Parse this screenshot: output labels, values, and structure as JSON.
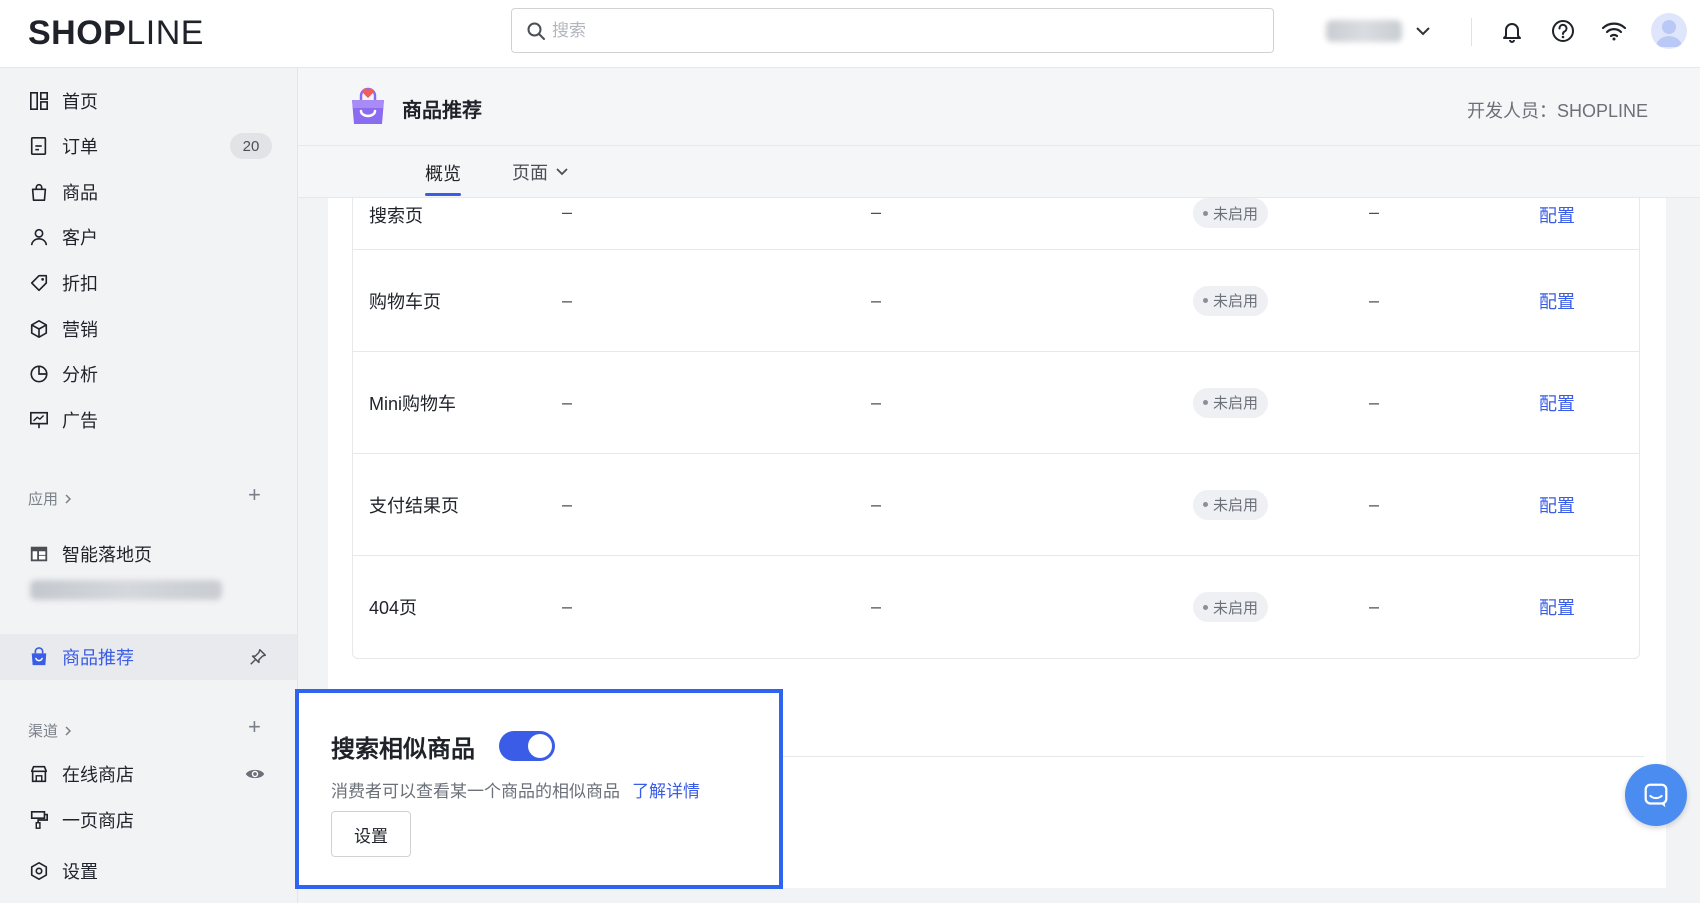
{
  "header": {
    "logo_bold": "SHOP",
    "logo_thin": "LINE",
    "search_placeholder": "搜索",
    "icons": [
      "bell-icon",
      "help-icon",
      "wifi-icon",
      "avatar"
    ]
  },
  "sidebar": {
    "items": [
      {
        "label": "首页",
        "icon": "dashboard-icon"
      },
      {
        "label": "订单",
        "icon": "order-icon",
        "badge": "20"
      },
      {
        "label": "商品",
        "icon": "bag-icon"
      },
      {
        "label": "客户",
        "icon": "user-icon"
      },
      {
        "label": "折扣",
        "icon": "tag-icon"
      },
      {
        "label": "营销",
        "icon": "cube-icon"
      },
      {
        "label": "分析",
        "icon": "pie-icon"
      },
      {
        "label": "广告",
        "icon": "ad-icon"
      }
    ],
    "apps_section": "应用",
    "apps": [
      {
        "label": "智能落地页",
        "icon": "layout-icon"
      },
      {
        "label": "商品推荐",
        "icon": "bag-smile-icon",
        "active": true
      }
    ],
    "channels_section": "渠道",
    "channels": [
      {
        "label": "在线商店",
        "icon": "store-icon"
      },
      {
        "label": "一页商店",
        "icon": "brush-icon"
      }
    ],
    "settings_label": "设置"
  },
  "app": {
    "title": "商品推荐",
    "developer": "开发人员：SHOPLINE",
    "tabs": {
      "overview": "概览",
      "pages": "页面"
    }
  },
  "table": {
    "rows": [
      {
        "name": "搜索页",
        "d1": "–",
        "d2": "–",
        "status": "未启用",
        "d3": "–",
        "action": "配置"
      },
      {
        "name": "购物车页",
        "d1": "–",
        "d2": "–",
        "status": "未启用",
        "d3": "–",
        "action": "配置"
      },
      {
        "name": "Mini购物车",
        "d1": "–",
        "d2": "–",
        "status": "未启用",
        "d3": "–",
        "action": "配置"
      },
      {
        "name": "支付结果页",
        "d1": "–",
        "d2": "–",
        "status": "未启用",
        "d3": "–",
        "action": "配置"
      },
      {
        "name": "404页",
        "d1": "–",
        "d2": "–",
        "status": "未启用",
        "d3": "–",
        "action": "配置"
      }
    ]
  },
  "feature": {
    "title": "搜索相似商品",
    "enabled": true,
    "description": "消费者可以查看某一个商品的相似商品",
    "learn_more": "了解详情",
    "settings_button": "设置"
  },
  "colors": {
    "accent": "#3a5ce6",
    "highlight_border": "#2f64f0",
    "chat": "#4a8cf0"
  }
}
